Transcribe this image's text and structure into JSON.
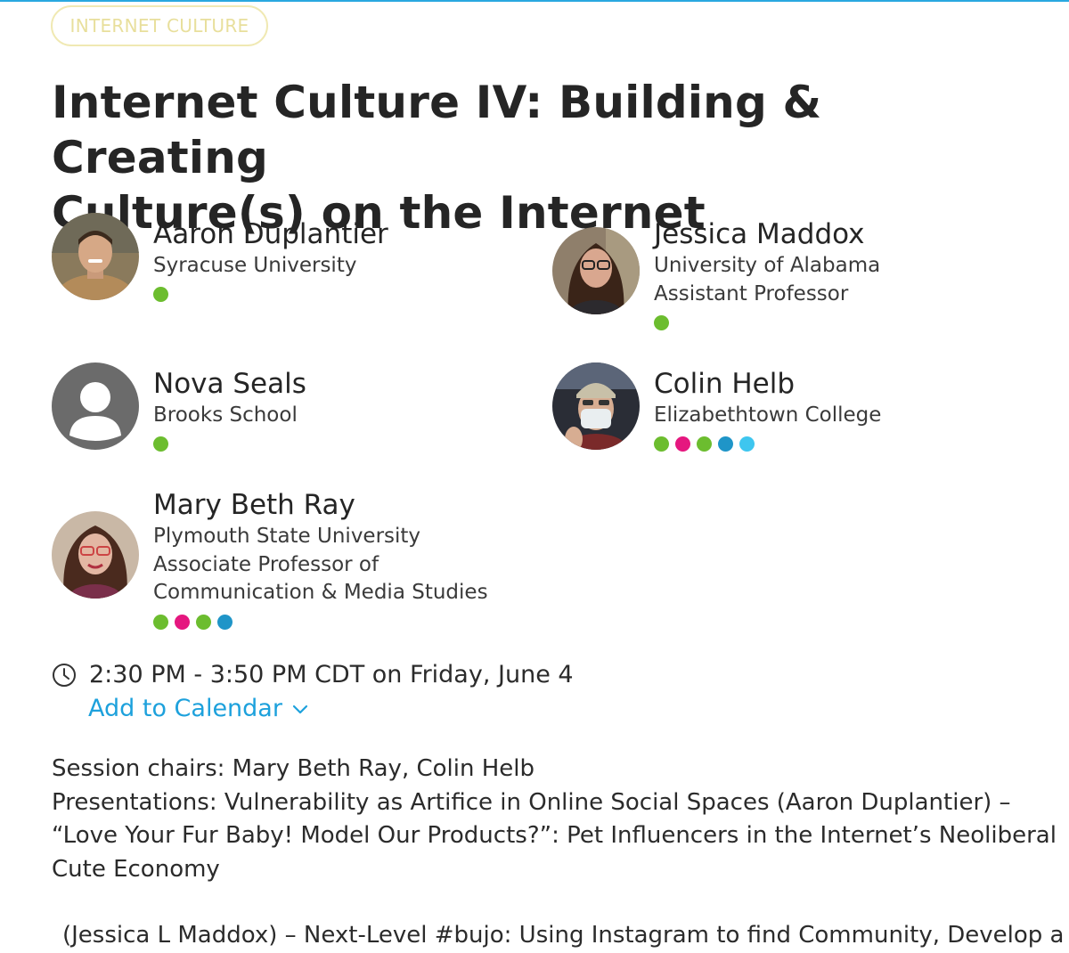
{
  "tag": "INTERNET CULTURE",
  "title_lines": [
    "Internet Culture IV: Building & Creating",
    "Culture(s) on the Internet"
  ],
  "speakers": [
    {
      "name": "Aaron Duplantier",
      "lines": [
        "Syracuse University"
      ],
      "dots": [
        "#6cbd2f"
      ],
      "avatar": "photo"
    },
    {
      "name": "Jessica Maddox",
      "lines": [
        "University of Alabama",
        "Assistant Professor"
      ],
      "dots": [
        "#6cbd2f"
      ],
      "avatar": "photo"
    },
    {
      "name": "Nova Seals",
      "lines": [
        "Brooks School"
      ],
      "dots": [
        "#6cbd2f"
      ],
      "avatar": "placeholder"
    },
    {
      "name": "Colin Helb",
      "lines": [
        "Elizabethtown College"
      ],
      "dots": [
        "#6cbd2f",
        "#e5177f",
        "#6cbd2f",
        "#1f95c8",
        "#3ec6ef"
      ],
      "avatar": "photo"
    },
    {
      "name": "Mary Beth Ray",
      "lines": [
        "Plymouth State University",
        "Associate Professor of",
        "Communication & Media Studies"
      ],
      "dots": [
        "#6cbd2f",
        "#e5177f",
        "#6cbd2f",
        "#1f95c8"
      ],
      "avatar": "photo"
    }
  ],
  "schedule": {
    "icon": "clock-icon",
    "time": "2:30 PM - 3:50 PM CDT on Friday, June 4",
    "add_to_calendar": "Add to Calendar",
    "dropdown_icon": "chevron-down-icon"
  },
  "description": {
    "lines": [
      "Session chairs: Mary Beth Ray, Colin Helb",
      "Presentations: Vulnerability as Artifice in Online Social Spaces (Aaron Duplantier) –",
      "“Love Your Fur Baby! Model Our Products?”: Pet Influencers in the Internet’s Neoliberal",
      "Cute Economy"
    ],
    "continuation": "(Jessica L Maddox) – Next-Level #bujo: Using Instagram to find Community, Develop a"
  },
  "colors": {
    "accent": "#1da1dc",
    "tag_border": "#f0e9b3",
    "tag_text": "#e8df9c",
    "dot_green": "#6cbd2f",
    "dot_pink": "#e5177f",
    "dot_blue": "#1f95c8",
    "dot_cyan": "#3ec6ef"
  }
}
